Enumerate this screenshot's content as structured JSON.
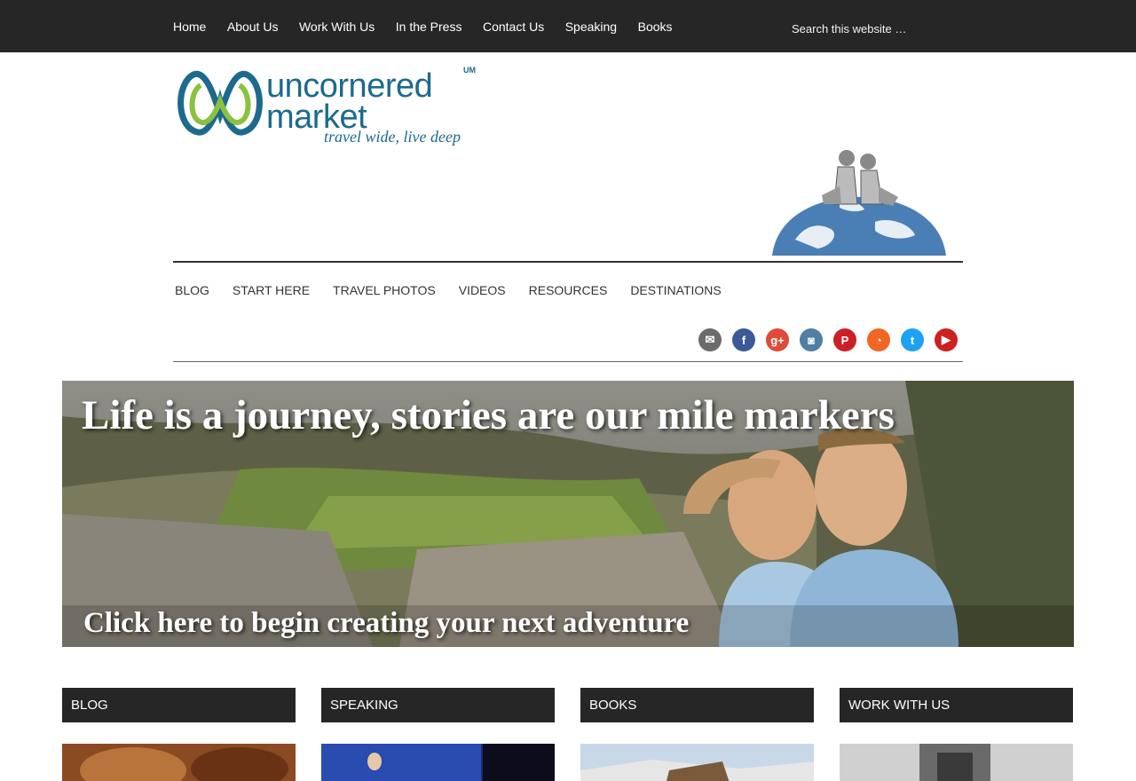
{
  "topnav": {
    "items": [
      "Home",
      "About Us",
      "Work With Us",
      "In the Press",
      "Contact Us",
      "Speaking",
      "Books"
    ],
    "search_placeholder": "Search this website …"
  },
  "logo": {
    "word1": "uncornered",
    "word2": "market",
    "tm": "UM",
    "tagline": "travel wide, live deep"
  },
  "mainnav": {
    "items": [
      "BLOG",
      "START HERE",
      "TRAVEL PHOTOS",
      "VIDEOS",
      "RESOURCES",
      "DESTINATIONS"
    ]
  },
  "social": [
    {
      "icon": "email-icon",
      "glyph": "✉",
      "color": "#6b6b6b"
    },
    {
      "icon": "facebook-icon",
      "glyph": "f",
      "color": "#3b5998"
    },
    {
      "icon": "google-plus-icon",
      "glyph": "g+",
      "color": "#dd4b39"
    },
    {
      "icon": "instagram-icon",
      "glyph": "◙",
      "color": "#517fa4"
    },
    {
      "icon": "pinterest-icon",
      "glyph": "P",
      "color": "#cb2027"
    },
    {
      "icon": "rss-icon",
      "glyph": "◔",
      "color": "#f26522"
    },
    {
      "icon": "twitter-icon",
      "glyph": "t",
      "color": "#1da1f2"
    },
    {
      "icon": "youtube-icon",
      "glyph": "▶",
      "color": "#cd201f"
    }
  ],
  "hero": {
    "title": "Life is a journey, stories are our mile markers",
    "cta": "Click here to begin creating your next adventure"
  },
  "widgets": [
    {
      "title": "BLOG"
    },
    {
      "title": "SPEAKING"
    },
    {
      "title": "BOOKS"
    },
    {
      "title": "WORK WITH US"
    }
  ]
}
